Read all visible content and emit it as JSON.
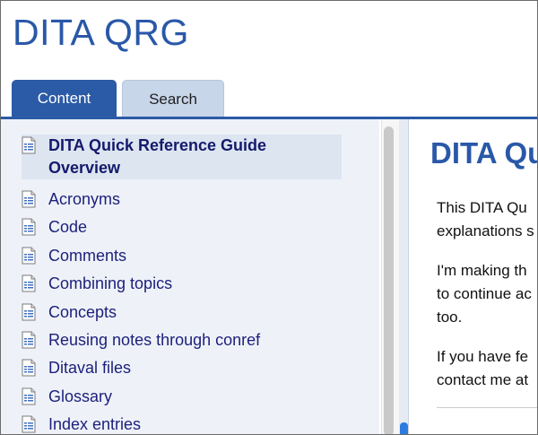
{
  "app": {
    "title": "DITA QRG"
  },
  "tabs": [
    {
      "label": "Content",
      "active": true
    },
    {
      "label": "Search",
      "active": false
    }
  ],
  "toc": [
    {
      "label_line1": "DITA Quick Reference Guide",
      "label_line2": "Overview",
      "selected": true
    },
    {
      "label": "Acronyms"
    },
    {
      "label": "Code"
    },
    {
      "label": "Comments"
    },
    {
      "label": "Combining topics"
    },
    {
      "label": "Concepts"
    },
    {
      "label": "Reusing notes through conref"
    },
    {
      "label": "Ditaval files"
    },
    {
      "label": "Glossary"
    },
    {
      "label": "Index entries"
    }
  ],
  "content": {
    "title": "DITA Qu",
    "paragraphs": [
      {
        "line1": "This DITA Qu",
        "line2": "explanations s"
      },
      {
        "line1": "I'm making th",
        "line2": "to continue ac",
        "line3": "too."
      },
      {
        "line1": "If you have fe",
        "line2": "contact me at"
      }
    ]
  },
  "colors": {
    "accent": "#2b5aa6",
    "title": "#2a58a8",
    "sidebar_bg": "#eef2f8",
    "link": "#1c1f7a"
  },
  "icons": {
    "toc_item": "document-icon"
  }
}
